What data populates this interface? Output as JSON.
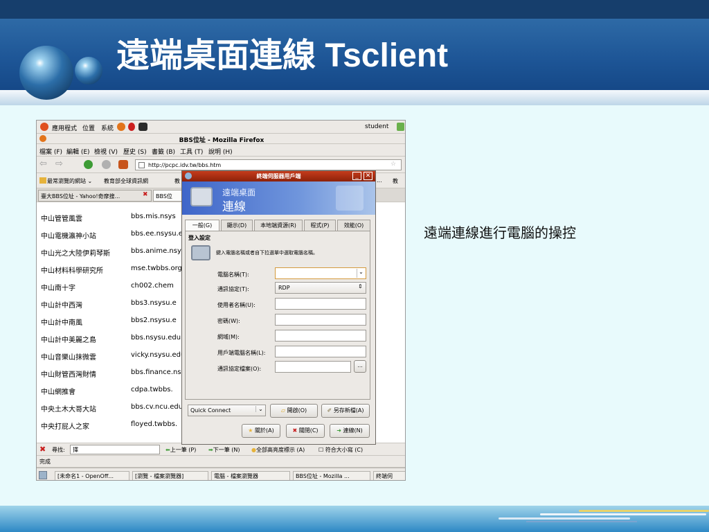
{
  "slide": {
    "title": "遠端桌面連線 Tsclient",
    "caption": "遠端連線進行電腦的操控"
  },
  "panel": {
    "menu_apps": "應用程式",
    "menu_places": "位置",
    "menu_system": "系統",
    "user": "student"
  },
  "firefox": {
    "window_title": "BBS位址 - Mozilla Firefox",
    "menu": [
      "檔案 (F)",
      "編輯 (E)",
      "檢視 (V)",
      "歷史 (S)",
      "書籤 (B)",
      "工具 (T)",
      "說明 (H)"
    ],
    "url": "http://pcpc.idv.tw/bbs.htm",
    "bookmarks": [
      "最常瀏覽的網站 ⌄",
      "教育部全球資訊網",
      "教",
      "...",
      "教"
    ],
    "tabs": [
      "臺大BBS位址 - Yahoo!奇摩搜...",
      "BBS位"
    ],
    "rows": [
      {
        "name": "中山管管風雲",
        "addr": "bbs.mis.nsys"
      },
      {
        "name": "中山電機瀛神小站",
        "addr": "bbs.ee.nsysu.e"
      },
      {
        "name": "中山光之大陸伊莉琴斯",
        "addr": "bbs.anime.nsys"
      },
      {
        "name": "中山材料科學研究所",
        "addr": "mse.twbbs.org"
      },
      {
        "name": "中山南十字",
        "addr": "ch002.chem"
      },
      {
        "name": "中山計中西灣",
        "addr": "bbs3.nsysu.e"
      },
      {
        "name": "中山計中南風",
        "addr": "bbs2.nsysu.e"
      },
      {
        "name": "中山計中美麗之島",
        "addr": "bbs.nsysu.edu"
      },
      {
        "name": "中山音樂山抹微雲",
        "addr": "vicky.nsysu.edu"
      },
      {
        "name": "中山財管西灣財情",
        "addr": "bbs.finance.nsy"
      },
      {
        "name": "中山網推會",
        "addr": "cdpa.twbbs."
      },
      {
        "name": "中央土木大哥大站",
        "addr": "bbs.cv.ncu.edu"
      },
      {
        "name": "中央打屁人之家",
        "addr": "floyed.twbbs."
      }
    ],
    "find_label": "尋找:",
    "find_value": "擇",
    "find_prev": "上一筆 (P)",
    "find_next": "下一筆 (N)",
    "find_highlight": "全部高亮度標示 (A)",
    "find_case": "符合大小寫 (C)",
    "status": "完成"
  },
  "dialog": {
    "title": "終端伺服器用戶端",
    "banner_line1": "遠端桌面",
    "banner_line2": "連線",
    "tabs": [
      "一般(G)",
      "顯示(D)",
      "本地端資源(R)",
      "程式(P)",
      "效能(O)"
    ],
    "section": "登入設定",
    "hint": "鍵入電腦名稱或者自下拉選單中選取電腦名稱。",
    "fields": [
      {
        "label": "電腦名稱(T):",
        "value": ""
      },
      {
        "label": "通訊協定(T):",
        "value": "RDP"
      },
      {
        "label": "使用者名稱(U):",
        "value": ""
      },
      {
        "label": "密碼(W):",
        "value": ""
      },
      {
        "label": "網域(M):",
        "value": ""
      },
      {
        "label": "用戶端電腦名稱(L):",
        "value": ""
      },
      {
        "label": "通訊協定檔案(O):",
        "value": ""
      }
    ],
    "browse": "...",
    "quick_connect": "Quick Connect",
    "open_btn": "開啟(O)",
    "save_btn": "另存新檔(A)",
    "about_btn": "關於(A)",
    "close_btn": "關閉(C)",
    "connect_btn": "連線(N)"
  },
  "taskbar": [
    "[未命名1 - OpenOff...",
    "[瀏覽 - 檔案瀏覽器]",
    "電腦 - 檔案瀏覽器",
    "BBS位址 - Mozilla ...",
    "終端伺"
  ]
}
